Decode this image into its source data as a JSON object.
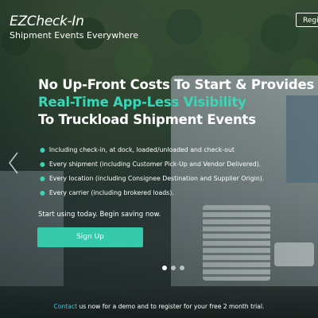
{
  "header": {
    "brand": "EZCheck-In",
    "tagline": "Shipment Events Everywhere",
    "top_button_label": "Regi"
  },
  "hero": {
    "headline_line1": "No Up-Front Costs To Start & Provides",
    "headline_line2": "Real-Time App-Less Visibility",
    "headline_line3": "To Truckload Shipment Events",
    "bullets": [
      "Including check-in, at dock, loaded/unloaded and check-out",
      "Every shipment (including Customer Pick-Up and Vendor Delivered).",
      "Every location (including Consignee Destination and Supplier Origin).",
      "Every carrier (including brokered loads)."
    ],
    "start_text": "Start using today. Begin saving now.",
    "signup_label": "Sign Up"
  },
  "carousel": {
    "slide_count": 3,
    "active_index": 0
  },
  "footer": {
    "contact_link": "Contact",
    "contact_text": " us now for a demo and to register for your free 2 month trial."
  },
  "colors": {
    "accent": "#38d7b7",
    "button": "#33c9aa",
    "link": "#41c4e0"
  },
  "icons": {
    "bullet": "teal-dot",
    "prev": "chevron-left-icon"
  }
}
